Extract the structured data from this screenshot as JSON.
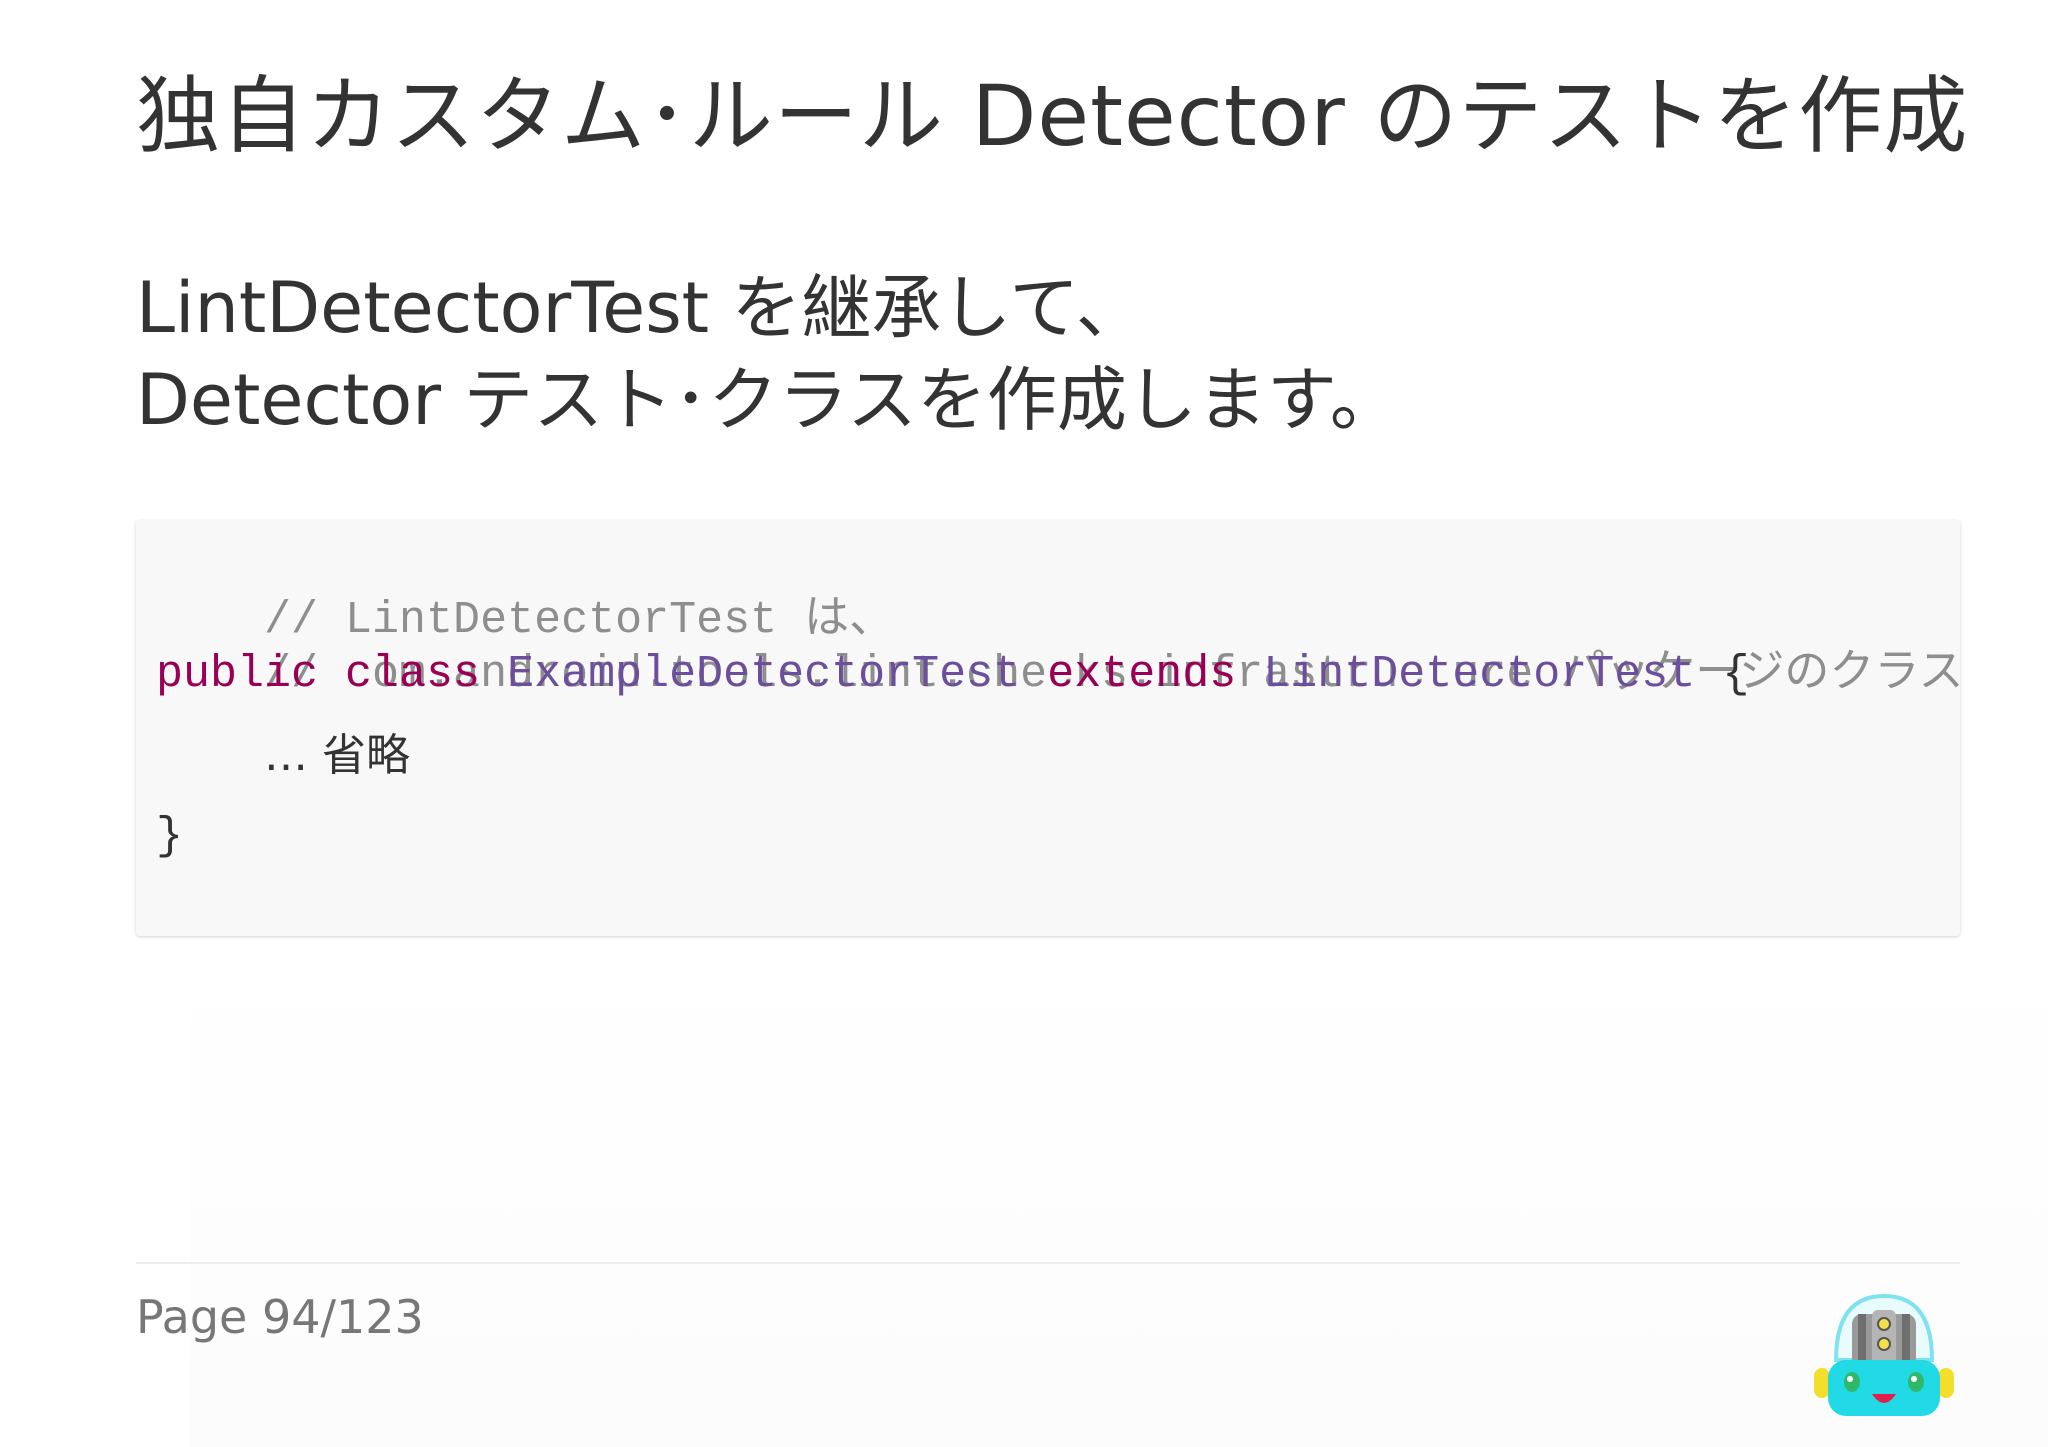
{
  "slide": {
    "title": "独自カスタム･ルール Detector のテストを作成",
    "lead_line1": "LintDetectorTest を継承して、",
    "lead_line2": "Detector テスト･クラスを作成します。"
  },
  "code": {
    "comment1": "// LintDetectorTest は、",
    "comment2": "// com.android.tools.lint.checks.infrastructure パッケージのクラス",
    "kw_public": "public",
    "kw_class": "class",
    "class_name": "ExampleDetectorTest",
    "kw_extends": "extends",
    "parent_class": "LintDetectorTest",
    "open_brace": "{",
    "omitted": "… 省略",
    "close_brace": "}"
  },
  "footer": {
    "page_label": "Page 94/123"
  },
  "icons": {
    "mascot": "robot-mascot-icon"
  },
  "colors": {
    "text": "#333333",
    "comment": "#8e8e8e",
    "keyword": "#990055",
    "class_name": "#6c4f9c",
    "code_background": "#f8f8f8",
    "page_number": "#777777"
  }
}
